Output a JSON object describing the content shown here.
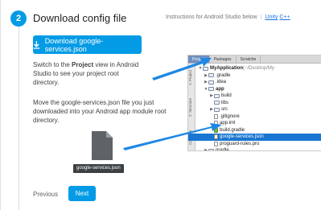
{
  "step": {
    "number": "2",
    "title": "Download config file",
    "instructions_prefix": "Instructions for Android Studio below",
    "link_unity": "Unity",
    "link_cpp": "C++"
  },
  "download_button": {
    "label": "Download google-services.json"
  },
  "paragraph1": {
    "pre": "Switch to the ",
    "bold": "Project",
    "post": " view in Android Studio to see your project root directory."
  },
  "paragraph2": "Move the google-services.json file you just downloaded into your Android app module root directory.",
  "file_label": "google-services.json",
  "nav": {
    "previous": "Previous",
    "next": "Next"
  },
  "ide": {
    "tabs": [
      "Project",
      "Packages",
      "Scratche"
    ],
    "side_labels": [
      "1: Project",
      "2: Structure",
      "Captures"
    ],
    "tree": [
      {
        "indent": 0,
        "toggle": "▼",
        "icon": "folder",
        "label": "MyApplication",
        "suffix": " (~/Desktop/My",
        "bold": true
      },
      {
        "indent": 1,
        "toggle": "▶",
        "icon": "folder",
        "label": ".gradle"
      },
      {
        "indent": 1,
        "toggle": "▶",
        "icon": "folder",
        "label": ".idea"
      },
      {
        "indent": 1,
        "toggle": "▼",
        "icon": "folder",
        "label": "app",
        "bold": true
      },
      {
        "indent": 2,
        "toggle": "▶",
        "icon": "folder",
        "label": "build"
      },
      {
        "indent": 2,
        "toggle": "",
        "icon": "folder",
        "label": "libs"
      },
      {
        "indent": 2,
        "toggle": "▶",
        "icon": "folder",
        "label": "src"
      },
      {
        "indent": 2,
        "toggle": "",
        "icon": "file",
        "label": ".gitignore"
      },
      {
        "indent": 2,
        "toggle": "",
        "icon": "file",
        "label": "app.iml"
      },
      {
        "indent": 2,
        "toggle": "",
        "icon": "green",
        "label": "build.gradle"
      },
      {
        "indent": 2,
        "toggle": "",
        "icon": "file",
        "label": "google-services.json",
        "selected": true
      },
      {
        "indent": 2,
        "toggle": "",
        "icon": "file",
        "label": "proguard-rules.pro"
      },
      {
        "indent": 1,
        "toggle": "▶",
        "icon": "folder",
        "label": "gradle"
      }
    ]
  },
  "colors": {
    "accent": "#039be5",
    "link": "#1a73e8",
    "arrow": "#1e88e5",
    "selection": "#1976d2"
  }
}
